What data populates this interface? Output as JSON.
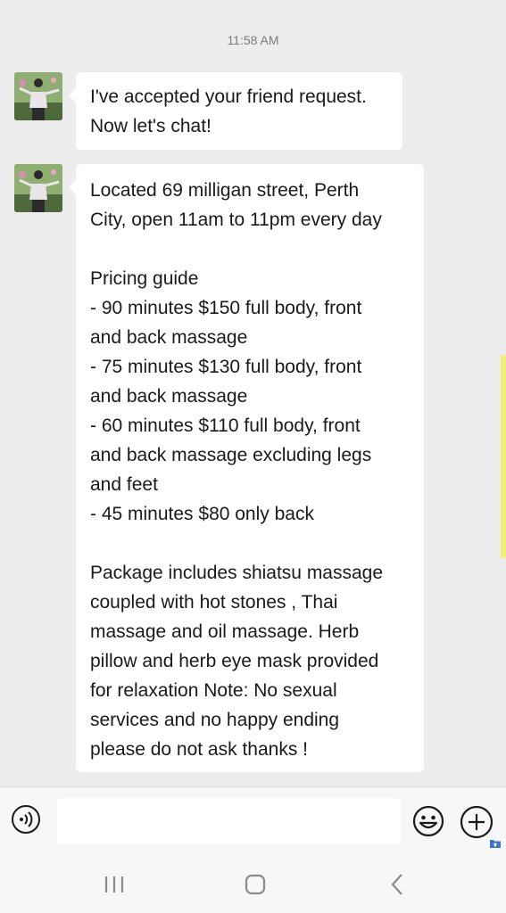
{
  "chat": {
    "timestamp": "11:58 AM",
    "messages": [
      {
        "sender_avatar_icon": "contact-avatar",
        "text": "I've accepted your friend request.\nNow let's chat!"
      },
      {
        "sender_avatar_icon": "contact-avatar",
        "text": "Located 69 milligan street, Perth\nCity, open 11am to 11pm every day\n\nPricing guide\n- 90 minutes $150 full body, front\nand back massage\n- 75 minutes $130 full body, front\nand back massage\n- 60 minutes $110 full body, front\nand back massage excluding legs\nand feet\n- 45 minutes $80 only back\n\nPackage includes shiatsu massage\ncoupled with hot stones , Thai\nmassage and oil massage. Herb\npillow and herb eye mask provided\nfor relaxation Note: No sexual\nservices and no happy ending\nplease do not ask thanks !"
      }
    ]
  },
  "input_bar": {
    "text_value": "",
    "icons": [
      "voice-icon",
      "emoji-icon",
      "plus-icon"
    ]
  },
  "nav_bar": {
    "icons": [
      "recent-apps-icon",
      "home-icon",
      "back-icon"
    ]
  },
  "colors": {
    "background": "#ededed",
    "bubble": "#ffffff",
    "timestamp": "#7a7a7a"
  }
}
